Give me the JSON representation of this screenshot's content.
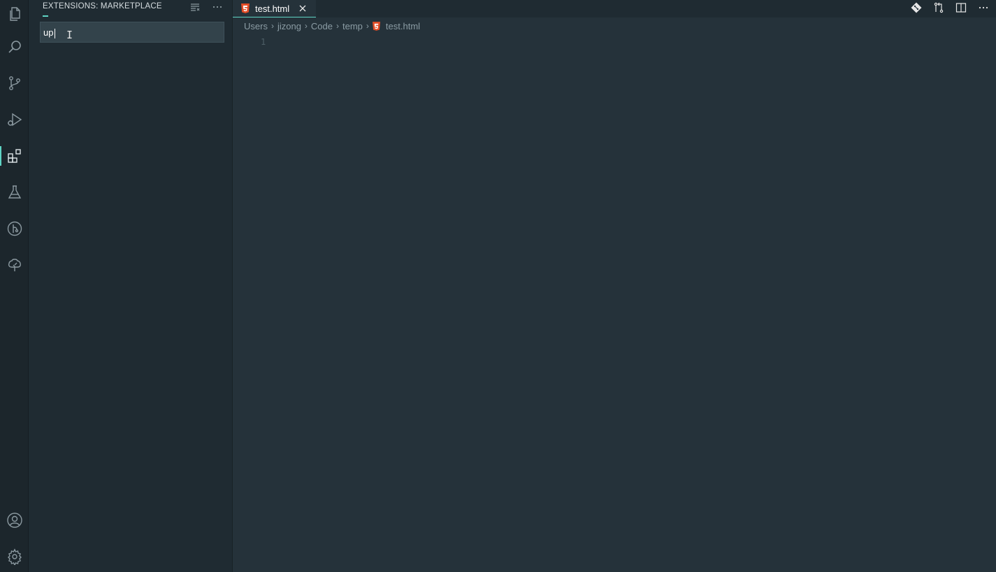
{
  "activity_bar": {
    "items": [
      {
        "name": "explorer",
        "icon": "files-icon"
      },
      {
        "name": "search",
        "icon": "search-icon"
      },
      {
        "name": "source-control",
        "icon": "source-control-icon"
      },
      {
        "name": "run-debug",
        "icon": "run-debug-icon"
      },
      {
        "name": "extensions",
        "icon": "extensions-icon",
        "active": true
      },
      {
        "name": "testing",
        "icon": "flask-icon"
      },
      {
        "name": "git-graph",
        "icon": "git-graph-icon"
      },
      {
        "name": "tree",
        "icon": "tree-icon"
      }
    ],
    "bottom": [
      {
        "name": "accounts",
        "icon": "account-icon"
      },
      {
        "name": "manage",
        "icon": "gear-icon"
      }
    ]
  },
  "sidebar": {
    "title": "EXTENSIONS: MARKETPLACE",
    "search_value": "up",
    "actions": [
      "clear-filter-icon",
      "more-icon"
    ]
  },
  "editor": {
    "tab": {
      "label": "test.html",
      "icon": "html5-icon"
    },
    "breadcrumb": [
      "Users",
      "jizong",
      "Code",
      "temp"
    ],
    "breadcrumb_file": "test.html",
    "line_number": "1",
    "actions": [
      "git-icon",
      "compare-changes-icon",
      "split-editor-icon",
      "more-icon"
    ]
  },
  "colors": {
    "accent": "#5fd4c4",
    "html_icon": "#e44d26",
    "background": "#25323a"
  }
}
